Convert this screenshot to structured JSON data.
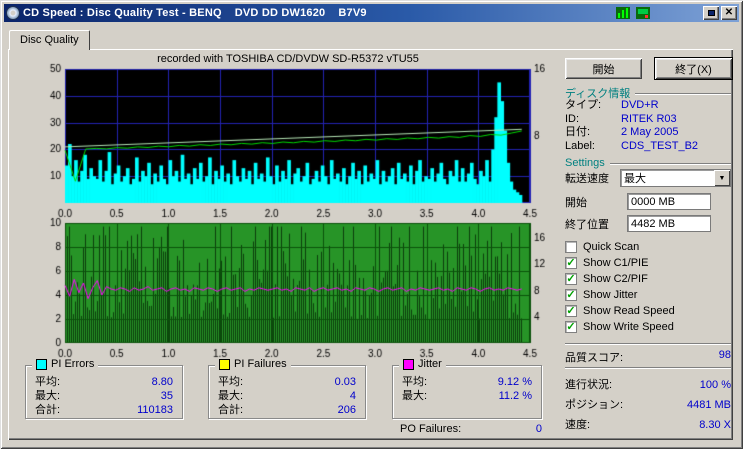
{
  "window": {
    "title": "CD Speed : Disc Quality Test - BENQ    DVD DD DW1620    B7V9"
  },
  "tabs": {
    "disc_quality": "Disc Quality"
  },
  "chart_header": "recorded with TOSHIBA CD/DVDW SD-R5372 vTU55",
  "icons": {
    "combo_arrow": "▼",
    "close": "✕",
    "check": "✓",
    "titlebar_icon_1": "graph-icon",
    "titlebar_icon_2": "monitor-icon"
  },
  "buttons": {
    "start": "開始",
    "exit": "終了(X)"
  },
  "disc_info": {
    "header": "ディスク情報",
    "rows": [
      {
        "label": "タイプ:",
        "value": "DVD+R"
      },
      {
        "label": "ID:",
        "value": "RITEK R03"
      },
      {
        "label": "日付:",
        "value": "2 May 2005"
      },
      {
        "label": "Label:",
        "value": "CDS_TEST_B2"
      }
    ]
  },
  "settings": {
    "header": "Settings",
    "speed_label": "転送速度",
    "speed_value": "最大",
    "start_label": "開始",
    "start_value": "0000 MB",
    "end_label": "終了位置",
    "end_value": "4482 MB",
    "checkboxes": [
      {
        "label": "Quick Scan",
        "checked": false
      },
      {
        "label": "Show C1/PIE",
        "checked": true
      },
      {
        "label": "Show C2/PIF",
        "checked": true
      },
      {
        "label": "Show Jitter",
        "checked": true
      },
      {
        "label": "Show Read Speed",
        "checked": true
      },
      {
        "label": "Show Write Speed",
        "checked": true
      }
    ]
  },
  "quality": {
    "label": "品質スコア:",
    "value": "98"
  },
  "status": [
    {
      "label": "進行状況:",
      "value": "100 %"
    },
    {
      "label": "ポジション:",
      "value": "4481 MB"
    },
    {
      "label": "速度:",
      "value": "8.30 X"
    }
  ],
  "legend": {
    "groups": [
      {
        "name": "pi-errors",
        "swatch": "#00ffff",
        "title": "PI Errors",
        "rows": [
          {
            "label": "平均:",
            "value": "8.80"
          },
          {
            "label": "最大:",
            "value": "35"
          },
          {
            "label": "合計:",
            "value": "110183"
          }
        ]
      },
      {
        "name": "pi-failures",
        "swatch": "#ffff00",
        "title": "PI Failures",
        "rows": [
          {
            "label": "平均:",
            "value": "0.03"
          },
          {
            "label": "最大:",
            "value": "4"
          },
          {
            "label": "合計:",
            "value": "206"
          }
        ]
      },
      {
        "name": "jitter",
        "swatch": "#ff00ff",
        "title": "Jitter",
        "rows": [
          {
            "label": "平均:",
            "value": "9.12 %"
          },
          {
            "label": "最大:",
            "value": "11.2 %"
          }
        ]
      }
    ],
    "po_failures": {
      "label": "PO Failures:",
      "value": "0"
    }
  },
  "colors": {
    "value_text": "#0000cc",
    "section_header": "#008080",
    "pi_errors": "#00ffff",
    "pi_failures": "#ffff00",
    "jitter": "#ff00ff",
    "read_speed": "#00dd00",
    "write_speed": "#b8eab8",
    "chart1_bg": "#000000",
    "chart1_grid": "#2323b4",
    "chart2_bg": "#279427",
    "chart2_grid": "#0a520a",
    "chart2_texture": "#0b3d0b",
    "titlebar_left": "#0a246a",
    "titlebar_right": "#7da1d6"
  },
  "chart_data": [
    {
      "type": "area",
      "title": "PI Errors / Read & Write Speed",
      "x_range": [
        0,
        4.5
      ],
      "x_data_max": 4.42,
      "x_ticks": [
        "0.0",
        "0.5",
        "1.0",
        "1.5",
        "2.0",
        "2.5",
        "3.0",
        "3.5",
        "4.0",
        "4.5"
      ],
      "y_left_range": [
        0,
        50
      ],
      "y_left_ticks": [
        10,
        20,
        30,
        40,
        50
      ],
      "y_right_max": 16,
      "y_right_ticks": [
        {
          "value": 16,
          "frac": 1.0
        },
        {
          "value": 8,
          "frac": 0.5
        }
      ],
      "bg": "#000000",
      "grid": "#2323b4",
      "color_pi": "#00ffff",
      "color_read": "#00dd00",
      "color_write": "#b8eab8",
      "series_pi_errors": [
        14,
        22,
        10,
        16,
        8,
        12,
        18,
        9,
        13,
        10,
        9,
        16,
        8,
        12,
        19,
        7,
        11,
        14,
        8,
        10,
        13,
        7,
        9,
        17,
        8,
        12,
        10,
        15,
        7,
        11,
        8,
        14,
        9,
        7,
        16,
        10,
        12,
        8,
        18,
        9,
        11,
        7,
        13,
        9,
        15,
        8,
        10,
        17,
        7,
        12,
        9,
        14,
        8,
        11,
        7,
        16,
        10,
        8,
        13,
        9,
        12,
        7,
        15,
        9,
        11,
        8,
        17,
        10,
        7,
        14,
        8,
        12,
        9,
        16,
        7,
        11,
        13,
        8,
        10,
        15,
        7,
        9,
        12,
        8,
        14,
        10,
        7,
        16,
        9,
        11,
        8,
        13,
        7,
        10,
        15,
        9,
        12,
        7,
        14,
        8,
        11,
        9,
        16,
        7,
        12,
        8,
        10,
        13,
        7,
        15,
        9,
        11,
        8,
        14,
        7,
        12,
        16,
        8,
        10,
        9,
        13,
        8,
        11,
        15,
        9,
        7,
        12,
        10,
        16,
        8,
        13,
        8,
        11,
        15,
        9,
        7,
        12,
        10,
        16,
        8,
        20,
        32,
        45,
        38,
        27,
        15,
        8,
        5,
        4,
        3
      ],
      "series_read_speed": [
        6.3,
        2.6,
        6.45,
        6.52,
        6.46,
        6.61,
        6.55,
        6.7,
        6.63,
        6.79,
        6.71,
        6.88,
        6.79,
        6.96,
        6.87,
        7.04,
        6.95,
        7.12,
        7.03,
        7.2,
        7.11,
        7.28,
        7.19,
        7.36,
        7.27,
        7.44,
        7.35,
        7.52,
        7.43,
        7.6,
        7.51,
        7.68,
        7.59,
        7.76,
        7.67,
        7.84,
        7.75,
        7.92,
        7.83,
        8.05,
        7.95,
        8.18,
        8.1,
        8.35,
        8.6
      ],
      "series_write_speed": [
        6.7,
        8.8
      ]
    },
    {
      "type": "line",
      "title": "Jitter",
      "x_range": [
        0,
        4.5
      ],
      "x_data_max": 4.42,
      "x_ticks": [
        "0.0",
        "0.5",
        "1.0",
        "1.5",
        "2.0",
        "2.5",
        "3.0",
        "3.5",
        "4.0",
        "4.5"
      ],
      "y_left_range": [
        0,
        10
      ],
      "y_left_ticks": [
        0,
        2,
        4,
        6,
        8,
        10
      ],
      "y_right_ticks": [
        {
          "value": 16,
          "frac": 0.874
        },
        {
          "value": 12,
          "frac": 0.655
        },
        {
          "value": 8,
          "frac": 0.437
        },
        {
          "value": 4,
          "frac": 0.218
        }
      ],
      "bg": "#279427",
      "grid": "#0a520a",
      "texture": "#0b3d0b",
      "noise_seed": 1234,
      "color_jitter": "#ff00ff",
      "series_jitter": [
        4.8,
        3.9,
        5.3,
        4.2,
        5.0,
        3.7,
        4.6,
        5.2,
        4.0,
        4.7,
        4.5,
        4.4,
        4.6,
        4.5,
        4.3,
        4.6,
        4.4,
        4.5,
        4.7,
        4.4,
        4.5,
        4.6,
        4.3,
        4.5,
        4.6,
        4.4,
        4.5,
        4.3,
        4.6,
        4.5,
        4.4,
        4.6,
        4.5,
        4.3,
        4.5,
        4.6,
        4.4,
        4.5,
        4.6,
        4.3,
        4.5,
        4.4,
        4.6,
        4.5,
        4.4,
        4.5,
        4.6,
        4.4,
        4.5,
        4.3,
        4.6,
        4.5,
        4.4,
        4.6,
        4.3,
        4.5,
        4.6,
        4.4,
        4.5,
        4.6,
        4.4,
        4.5,
        4.3,
        4.6,
        4.5,
        4.4,
        4.6,
        4.5,
        4.3,
        4.5,
        4.6,
        4.4,
        4.5,
        4.6,
        4.3,
        4.5,
        4.4,
        4.6,
        4.5,
        4.4,
        4.5,
        4.6,
        4.4,
        4.5,
        4.3,
        4.6,
        4.5,
        4.4,
        4.6,
        4.5,
        4.3,
        4.5,
        4.6,
        4.4,
        4.5,
        4.4,
        4.6,
        4.5,
        4.4,
        4.5
      ]
    }
  ]
}
